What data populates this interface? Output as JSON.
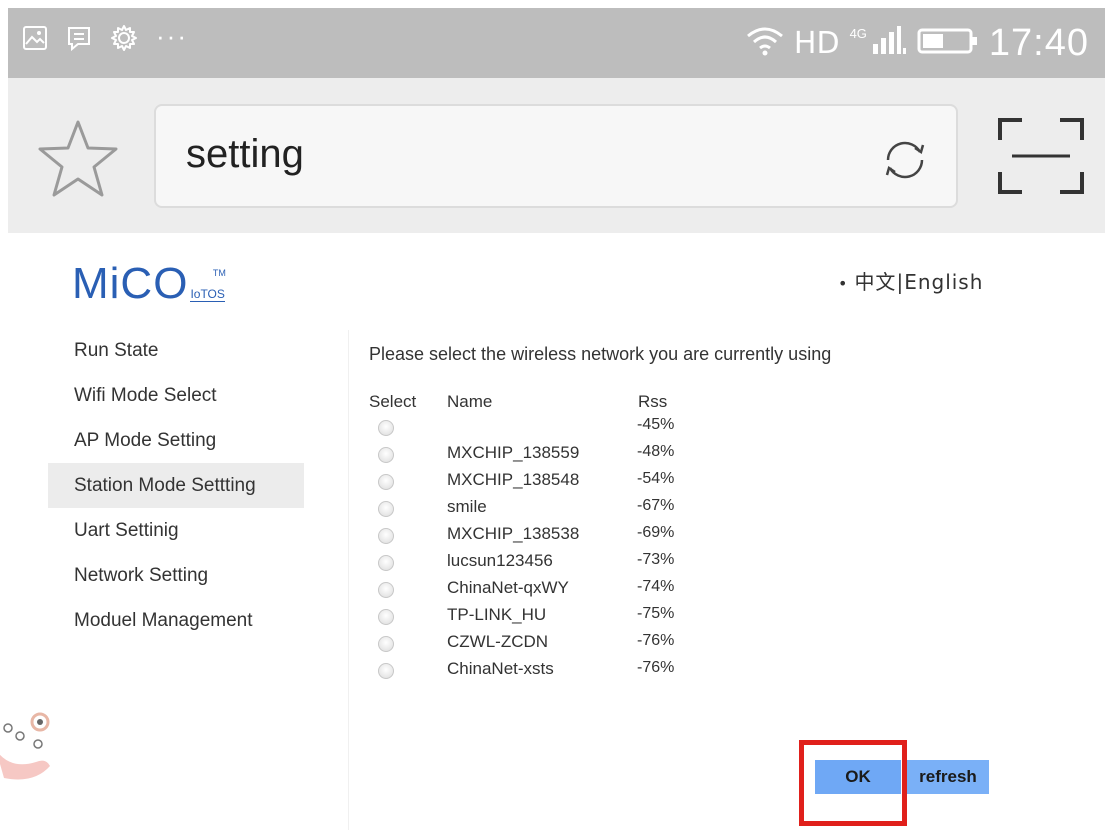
{
  "status_bar": {
    "left_icons": [
      "image-icon",
      "message-icon",
      "gear-icon",
      "more-dots-icon"
    ],
    "more": "···",
    "network_label": "HD",
    "network_gen": "4G",
    "time": "17:40"
  },
  "browser": {
    "url_text": "setting"
  },
  "logo": {
    "main": "MiCO",
    "sub": "IoTOS",
    "tm": "TM"
  },
  "lang": {
    "bullet": "•",
    "chinese": "中文",
    "separator": "|",
    "english": "English"
  },
  "sidebar": {
    "items": [
      {
        "label": "Run State",
        "active": false
      },
      {
        "label": "Wifi Mode Select",
        "active": false
      },
      {
        "label": "AP Mode Setting",
        "active": false
      },
      {
        "label": "Station Mode Settting",
        "active": true
      },
      {
        "label": "Uart Settinig",
        "active": false
      },
      {
        "label": "Network Setting",
        "active": false
      },
      {
        "label": "Moduel Management",
        "active": false
      }
    ]
  },
  "main": {
    "prompt": "Please select the wireless network you are currently using",
    "columns": {
      "select": "Select",
      "name": "Name",
      "rss": "Rss"
    },
    "networks": [
      {
        "name": "",
        "rss": "-45%"
      },
      {
        "name": "MXCHIP_138559",
        "rss": "-48%"
      },
      {
        "name": "MXCHIP_138548",
        "rss": "-54%"
      },
      {
        "name": "smile",
        "rss": "-67%"
      },
      {
        "name": "MXCHIP_138538",
        "rss": "-69%"
      },
      {
        "name": "lucsun123456",
        "rss": "-73%"
      },
      {
        "name": "ChinaNet-qxWY",
        "rss": "-74%"
      },
      {
        "name": "TP-LINK_HU",
        "rss": "-75%"
      },
      {
        "name": "CZWL-ZCDN",
        "rss": "-76%"
      },
      {
        "name": "ChinaNet-xsts",
        "rss": "-76%"
      }
    ],
    "ok_label": "OK",
    "refresh_label": "refresh"
  },
  "colors": {
    "brand": "#2a5fb4",
    "button": "#6fa8f5",
    "highlight": "#e0201b",
    "status_bar": "#bdbdbd"
  }
}
